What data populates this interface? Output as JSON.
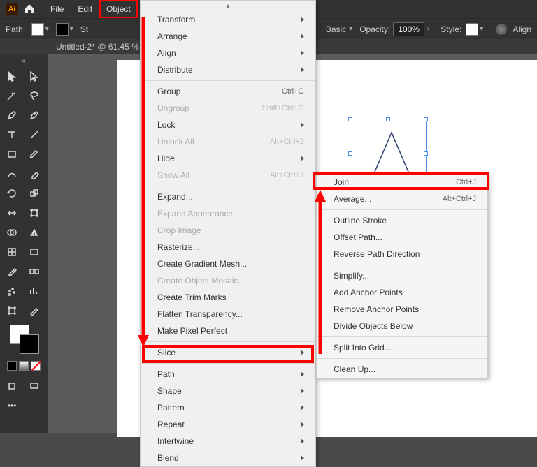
{
  "menubar": {
    "file": "File",
    "edit": "Edit",
    "object": "Object"
  },
  "control_bar": {
    "path_label": "Path",
    "stroke_label": "St",
    "basic_label": "Basic",
    "opacity_label": "Opacity:",
    "opacity_value": "100%",
    "style_label": "Style:",
    "align_label": "Align"
  },
  "doc_tab": "Untitled-2* @ 61.45 %",
  "object_menu": {
    "transform": "Transform",
    "arrange": "Arrange",
    "align": "Align",
    "distribute": "Distribute",
    "group": {
      "label": "Group",
      "shortcut": "Ctrl+G"
    },
    "ungroup": {
      "label": "Ungroup",
      "shortcut": "Shift+Ctrl+G"
    },
    "lock": "Lock",
    "unlock_all": {
      "label": "Unlock All",
      "shortcut": "Alt+Ctrl+2"
    },
    "hide": "Hide",
    "show_all": {
      "label": "Show All",
      "shortcut": "Alt+Ctrl+3"
    },
    "expand": "Expand...",
    "expand_appearance": "Expand Appearance",
    "crop_image": "Crop Image",
    "rasterize": "Rasterize...",
    "create_gradient_mesh": "Create Gradient Mesh...",
    "create_object_mosaic": "Create Object Mosaic...",
    "create_trim_marks": "Create Trim Marks",
    "flatten_transparency": "Flatten Transparency...",
    "make_pixel_perfect": "Make Pixel Perfect",
    "slice": "Slice",
    "path": "Path",
    "shape": "Shape",
    "pattern": "Pattern",
    "repeat": "Repeat",
    "intertwine": "Intertwine",
    "blend": "Blend"
  },
  "path_submenu": {
    "join": {
      "label": "Join",
      "shortcut": "Ctrl+J"
    },
    "average": {
      "label": "Average...",
      "shortcut": "Alt+Ctrl+J"
    },
    "outline_stroke": "Outline Stroke",
    "offset_path": "Offset Path...",
    "reverse_path_direction": "Reverse Path Direction",
    "simplify": "Simplify...",
    "add_anchor_points": "Add Anchor Points",
    "remove_anchor_points": "Remove Anchor Points",
    "divide_objects_below": "Divide Objects Below",
    "split_into_grid": "Split Into Grid...",
    "clean_up": "Clean Up..."
  }
}
